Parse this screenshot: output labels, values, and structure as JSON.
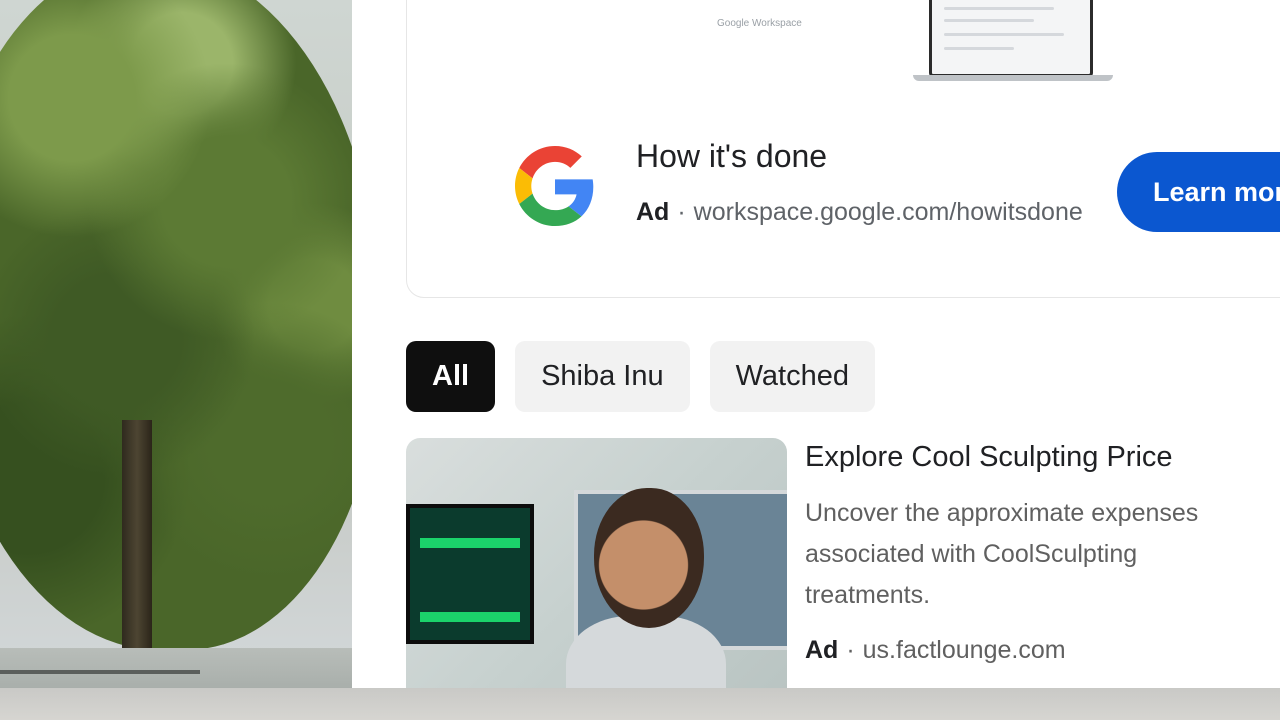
{
  "top_ad": {
    "hero_text": "Google Workspace",
    "title": "How it's done",
    "ad_label": "Ad",
    "separator": "·",
    "url": "workspace.google.com/howitsdone",
    "cta_label": "Learn more",
    "info_icon": "i",
    "logo": "google-g-logo",
    "accent_color": "#0b57d0"
  },
  "chips": [
    {
      "label": "All",
      "selected": true
    },
    {
      "label": "Shiba Inu",
      "selected": false
    },
    {
      "label": "Watched",
      "selected": false
    }
  ],
  "second_ad": {
    "title": "Explore Cool Sculpting Price",
    "description": "Uncover the approximate expenses associated with CoolSculpting treatments.",
    "ad_label": "Ad",
    "separator": "·",
    "url": "us.factlounge.com"
  }
}
